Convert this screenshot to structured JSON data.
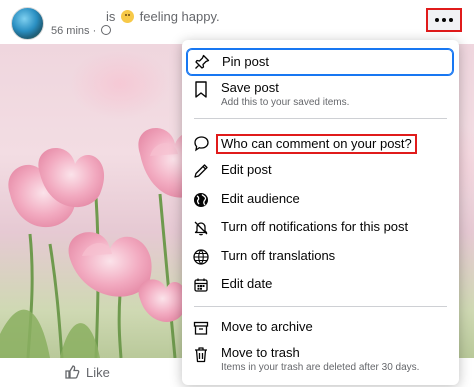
{
  "post": {
    "status_prefix": "is",
    "status_suffix": "feeling happy.",
    "time": "56 mins",
    "separator": "·",
    "like_label": "Like"
  },
  "menu": {
    "pin_label": "Pin post",
    "save_label": "Save post",
    "save_sub": "Add this to your saved items.",
    "comment_label": "Who can comment on your post?",
    "edit_post_label": "Edit post",
    "edit_audience_label": "Edit audience",
    "notifications_label": "Turn off notifications for this post",
    "translations_label": "Turn off translations",
    "edit_date_label": "Edit date",
    "archive_label": "Move to archive",
    "trash_label": "Move to trash",
    "trash_sub": "Items in your trash are deleted after 30 days."
  },
  "colors": {
    "highlight": "#e01b1b",
    "focus_ring": "#1877f2",
    "muted_text": "#65676b"
  },
  "icons": [
    "pin-icon",
    "bookmark-icon",
    "comment-icon",
    "pencil-icon",
    "globe-icon",
    "bell-off-icon",
    "translate-icon",
    "calendar-icon",
    "archive-icon",
    "trash-icon",
    "thumbs-up-icon",
    "more-icon"
  ]
}
